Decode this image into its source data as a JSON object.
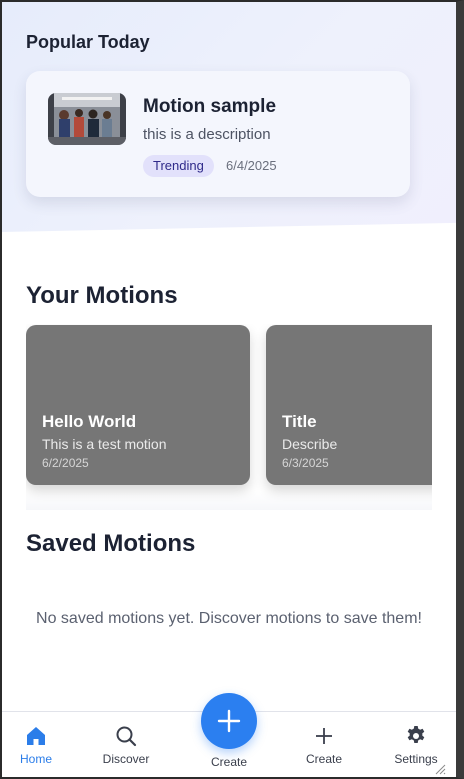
{
  "popular": {
    "heading": "Popular Today",
    "card": {
      "title": "Motion sample",
      "description": "this is a description",
      "badge": "Trending",
      "date": "6/4/2025"
    }
  },
  "your_motions": {
    "heading": "Your Motions",
    "items": [
      {
        "title": "Hello World",
        "description": "This is a test motion",
        "date": "6/2/2025"
      },
      {
        "title": "Title",
        "description": "Describe",
        "date": "6/3/2025"
      }
    ]
  },
  "saved_motions": {
    "heading": "Saved Motions",
    "empty_message": "No saved motions yet. Discover motions to save them!"
  },
  "bottom_nav": {
    "items": [
      {
        "label": "Home",
        "icon": "home-icon",
        "active": true
      },
      {
        "label": "Discover",
        "icon": "search-icon",
        "active": false
      },
      {
        "label": "Create",
        "icon": "plus-icon",
        "active": false
      },
      {
        "label": "Create",
        "icon": "plus-icon",
        "active": false
      },
      {
        "label": "Settings",
        "icon": "gear-icon",
        "active": false
      }
    ]
  },
  "colors": {
    "accent": "#2b7ff0",
    "card_gray": "#767676",
    "badge_bg": "#e2e1fb"
  }
}
